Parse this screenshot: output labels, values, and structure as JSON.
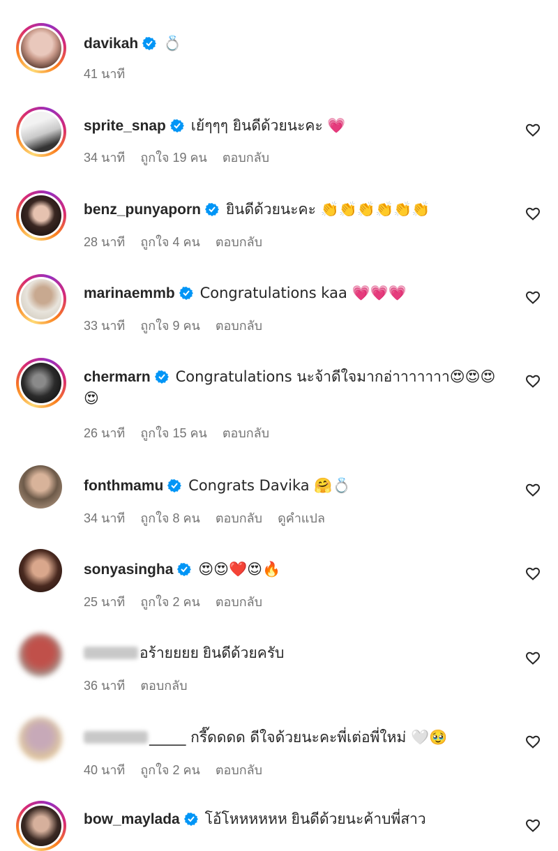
{
  "comments": [
    {
      "username": "davikah",
      "verified": true,
      "body": "💍",
      "time": "41 นาที",
      "likes": "",
      "reply": "",
      "translate": "",
      "likeable": false
    },
    {
      "username": "sprite_snap",
      "verified": true,
      "body": "เย้ๆๆๆ ยินดีด้วยนะคะ 💗",
      "time": "34 นาที",
      "likes": "ถูกใจ 19 คน",
      "reply": "ตอบกลับ",
      "translate": ""
    },
    {
      "username": "benz_punyaporn",
      "verified": true,
      "body": "ยินดีด้วยนะคะ 👏👏👏👏👏👏",
      "time": "28 นาที",
      "likes": "ถูกใจ 4 คน",
      "reply": "ตอบกลับ",
      "translate": ""
    },
    {
      "username": "marinaemmb",
      "verified": true,
      "body": "Congratulations kaa 💗💗💗",
      "time": "33 นาที",
      "likes": "ถูกใจ 9 คน",
      "reply": "ตอบกลับ",
      "translate": ""
    },
    {
      "username": "chermarn",
      "verified": true,
      "body": "Congratulations นะจ้าดีใจมากอ่าาาาาาา😍😍😍😍",
      "time": "26 นาที",
      "likes": "ถูกใจ 15 คน",
      "reply": "ตอบกลับ",
      "translate": ""
    },
    {
      "username": "fonthmamu",
      "verified": true,
      "body": "Congrats Davika 🤗💍",
      "time": "34 นาที",
      "likes": "ถูกใจ 8 คน",
      "reply": "ตอบกลับ",
      "translate": "ดูคำแปล"
    },
    {
      "username": "sonyasingha",
      "verified": true,
      "body": "😍😍❤️😍🔥",
      "time": "25 นาที",
      "likes": "ถูกใจ 2 คน",
      "reply": "ตอบกลับ",
      "translate": ""
    },
    {
      "username": "",
      "verified": false,
      "body": "อร้ายยยย ยินดีด้วยครับ",
      "time": "36 นาที",
      "likes": "",
      "reply": "ตอบกลับ",
      "translate": ""
    },
    {
      "username": "",
      "verified": false,
      "body": "_____ กรี๊ดดดด ดีใจด้วยนะคะพี่เต่อพี่ใหม่ 🤍🥹",
      "time": "40 นาที",
      "likes": "ถูกใจ 2 คน",
      "reply": "ตอบกลับ",
      "translate": ""
    },
    {
      "username": "bow_maylada",
      "verified": true,
      "body": "โอ้โหหหหหห ยินดีด้วยนะค้าบพี่สาว",
      "time": "",
      "likes": "",
      "reply": "",
      "translate": ""
    }
  ],
  "colors": {
    "verified": "#0095f6",
    "meta": "#737373",
    "text": "#262626"
  }
}
